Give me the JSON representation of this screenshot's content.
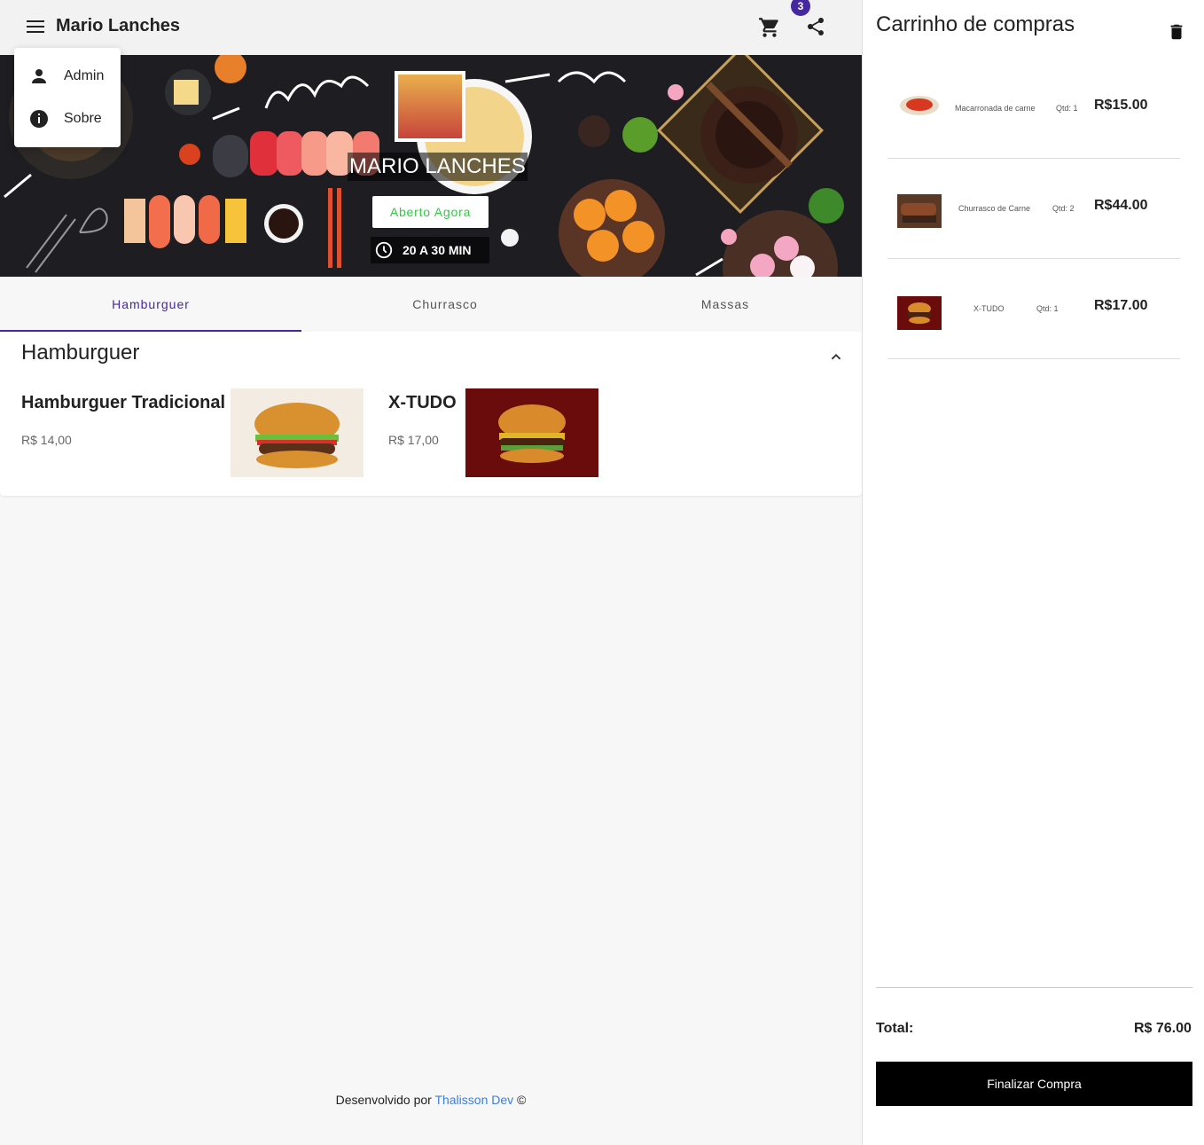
{
  "header": {
    "title": "Mario Lanches",
    "cart_count": "3"
  },
  "menu": {
    "items": [
      {
        "label": "Admin",
        "icon": "person-icon"
      },
      {
        "label": "Sobre",
        "icon": "info-icon"
      }
    ]
  },
  "banner": {
    "store_name": "MARIO LANCHES",
    "status": "Aberto Agora",
    "delivery_time": "20 A 30 MIN"
  },
  "tabs": [
    {
      "label": "Hamburguer",
      "active": true
    },
    {
      "label": "Churrasco",
      "active": false
    },
    {
      "label": "Massas",
      "active": false
    }
  ],
  "section": {
    "title": "Hamburguer",
    "products": [
      {
        "name": "Hamburguer Tradicional",
        "price": "R$ 14,00"
      },
      {
        "name": "X-TUDO",
        "price": "R$ 17,00"
      }
    ]
  },
  "footer": {
    "prefix": "Desenvolvido por",
    "link": "Thalisson Dev",
    "suffix": "©"
  },
  "cart": {
    "title": "Carrinho de compras",
    "items": [
      {
        "name": "Macarronada de carne",
        "qty": "Qtd: 1",
        "price": "R$15.00"
      },
      {
        "name": "Churrasco de Carne",
        "qty": "Qtd: 2",
        "price": "R$44.00"
      },
      {
        "name": "X-TUDO",
        "qty": "Qtd: 1",
        "price": "R$17.00"
      }
    ],
    "total_label": "Total:",
    "total_value": "R$ 76.00",
    "checkout_label": "Finalizar Compra"
  },
  "colors": {
    "accent": "#4527a0",
    "open_status": "#2ecc40",
    "link": "#3f7fd1"
  }
}
